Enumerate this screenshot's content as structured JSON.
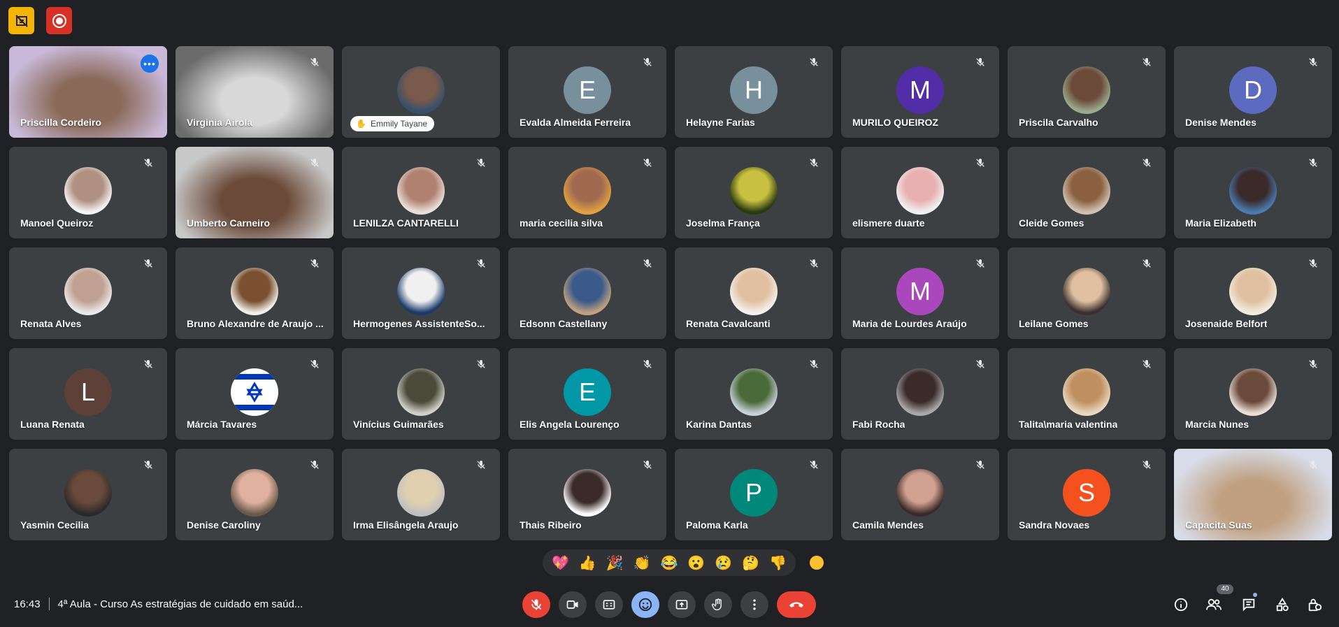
{
  "participants": [
    {
      "name": "Priscilla Cordeiro",
      "video": true,
      "colors": [
        "#8a6b5a",
        "#c9b8d8"
      ],
      "active": true
    },
    {
      "name": "Virginia Airola",
      "video": true,
      "colors": [
        "#d8d8d8",
        "#6b6b6b"
      ]
    },
    {
      "name": "",
      "pill": "Emmily Tayane",
      "avatar": "photo",
      "colors": [
        "#7a5a4a",
        "#35506a"
      ]
    },
    {
      "name": "Evalda Almeida Ferreira",
      "initial": "E",
      "color": "#78909c"
    },
    {
      "name": "Helayne Farias",
      "initial": "H",
      "color": "#78909c"
    },
    {
      "name": "MURILO QUEIROZ",
      "initial": "M",
      "color": "#512da8"
    },
    {
      "name": "Priscila Carvalho",
      "avatar": "photo",
      "colors": [
        "#6b4a3a",
        "#9aaa8a"
      ]
    },
    {
      "name": "Denise Mendes",
      "initial": "D",
      "color": "#5c6bc0"
    },
    {
      "name": "Manoel Queiroz",
      "avatar": "photo",
      "colors": [
        "#b09080",
        "#f4f4f4"
      ]
    },
    {
      "name": "Umberto Carneiro",
      "video": true,
      "colors": [
        "#6b4a3a",
        "#c8c8c8"
      ]
    },
    {
      "name": "LENILZA CANTARELLI",
      "avatar": "photo",
      "colors": [
        "#b08070",
        "#e8e0d8"
      ]
    },
    {
      "name": "maria cecilia silva",
      "avatar": "photo",
      "colors": [
        "#a06a50",
        "#e0a040"
      ]
    },
    {
      "name": "Joselma França",
      "avatar": "photo",
      "colors": [
        "#c8c040",
        "#2a3a10"
      ]
    },
    {
      "name": "elismere duarte",
      "avatar": "photo",
      "colors": [
        "#e8b0b0",
        "#f0f0f0"
      ]
    },
    {
      "name": "Cleide Gomes",
      "avatar": "photo",
      "colors": [
        "#8a6040",
        "#d0c0b0"
      ]
    },
    {
      "name": "Maria Elizabeth",
      "avatar": "photo",
      "colors": [
        "#3a2a2a",
        "#4a7ab0"
      ]
    },
    {
      "name": "Renata Alves",
      "avatar": "photo",
      "colors": [
        "#c0a090",
        "#e8e8e8"
      ]
    },
    {
      "name": "Bruno Alexandre de Araujo ...",
      "avatar": "photo",
      "colors": [
        "#7a5030",
        "#f0f0e8"
      ]
    },
    {
      "name": "Hermogenes AssistenteSo...",
      "avatar": "photo",
      "colors": [
        "#f0f0f0",
        "#1a3a6a"
      ]
    },
    {
      "name": "Edsonn Castellany",
      "avatar": "photo",
      "colors": [
        "#3a5a8a",
        "#c0a080"
      ]
    },
    {
      "name": "Renata Cavalcanti",
      "avatar": "photo",
      "colors": [
        "#e0c0a0",
        "#f4f0ec"
      ]
    },
    {
      "name": "Maria de Lourdes Araújo",
      "initial": "M",
      "color": "#ab47bc"
    },
    {
      "name": "Leilane Gomes",
      "avatar": "photo",
      "colors": [
        "#e0c0a0",
        "#3a3030"
      ]
    },
    {
      "name": "Josenaide Belfort",
      "avatar": "photo",
      "colors": [
        "#e0c0a0",
        "#f0ece0"
      ]
    },
    {
      "name": "Luana Renata",
      "initial": "L",
      "color": "#5d4037"
    },
    {
      "name": "Márcia Tavares",
      "avatar": "flag",
      "colors": [
        "#ffffff",
        "#0038b8"
      ]
    },
    {
      "name": "Vinícius Guimarães",
      "avatar": "photo",
      "colors": [
        "#4a4a3a",
        "#d0d0c8"
      ]
    },
    {
      "name": "Elis Angela Lourenço",
      "initial": "E",
      "color": "#0097a7"
    },
    {
      "name": "Karina Dantas",
      "avatar": "photo",
      "colors": [
        "#4a6a3a",
        "#c8d0d8"
      ]
    },
    {
      "name": "Fabi Rocha",
      "avatar": "photo",
      "colors": [
        "#3a2a2a",
        "#a8a8a8"
      ]
    },
    {
      "name": "Talita\\maria valentina",
      "avatar": "photo",
      "colors": [
        "#c09060",
        "#e8d8c0"
      ]
    },
    {
      "name": "Marcia Nunes",
      "avatar": "photo",
      "colors": [
        "#6a4a3a",
        "#e8e0d8"
      ]
    },
    {
      "name": "Yasmin Cecilia",
      "avatar": "photo",
      "colors": [
        "#6a4a3a",
        "#2a2a2a"
      ]
    },
    {
      "name": "Denise Caroliny",
      "avatar": "photo",
      "colors": [
        "#e0b0a0",
        "#6a5a4a"
      ]
    },
    {
      "name": "Irma Elisângela Araujo",
      "avatar": "photo",
      "colors": [
        "#e0d0b0",
        "#c0c0c0"
      ]
    },
    {
      "name": "Thais Ribeiro",
      "avatar": "photo",
      "colors": [
        "#3a2a2a",
        "#ffffff"
      ]
    },
    {
      "name": "Paloma Karla",
      "initial": "P",
      "color": "#00897b"
    },
    {
      "name": "Camila Mendes",
      "avatar": "photo",
      "colors": [
        "#d0a090",
        "#3a2a2a"
      ]
    },
    {
      "name": "Sandra Novaes",
      "initial": "S",
      "color": "#f4511e"
    },
    {
      "name": "Capacita Suas",
      "video": true,
      "colors": [
        "#c0a080",
        "#d8dce8"
      ]
    }
  ],
  "reactions": [
    "💖",
    "👍",
    "🎉",
    "👏",
    "😂",
    "😮",
    "😢",
    "🤔",
    "👎"
  ],
  "bottom_bar": {
    "clock": "16:43",
    "meeting_title": "4ª Aula - Curso As estratégias de cuidado em saúd...",
    "people_count": "40"
  },
  "colors": {
    "accent": "#8ab4f8",
    "hangup": "#ea4335",
    "tile_bg": "#3c4043",
    "background": "#202124"
  }
}
